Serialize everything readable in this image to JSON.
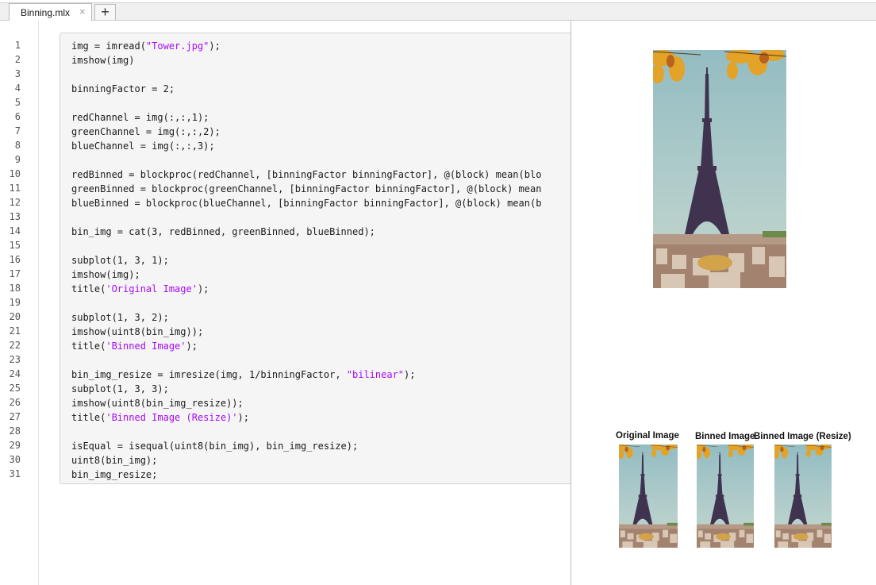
{
  "tab": {
    "label": "Binning.mlx",
    "close_glyph": "×",
    "new_glyph": "+"
  },
  "code": {
    "lines": [
      [
        {
          "t": "img = imread("
        },
        {
          "t": "\"Tower.jpg\"",
          "c": "str"
        },
        {
          "t": ");"
        }
      ],
      [
        {
          "t": "imshow(img)"
        }
      ],
      [],
      [
        {
          "t": "binningFactor = 2;"
        }
      ],
      [],
      [
        {
          "t": "redChannel = img(:,:,1);"
        }
      ],
      [
        {
          "t": "greenChannel = img(:,:,2);"
        }
      ],
      [
        {
          "t": "blueChannel = img(:,:,3);"
        }
      ],
      [],
      [
        {
          "t": "redBinned = blockproc(redChannel, [binningFactor binningFactor], @(block) mean(blo"
        }
      ],
      [
        {
          "t": "greenBinned = blockproc(greenChannel, [binningFactor binningFactor], @(block) mean"
        }
      ],
      [
        {
          "t": "blueBinned = blockproc(blueChannel, [binningFactor binningFactor], @(block) mean(b"
        }
      ],
      [],
      [
        {
          "t": "bin_img = cat(3, redBinned, greenBinned, blueBinned);"
        }
      ],
      [],
      [
        {
          "t": "subplot(1, 3, 1);"
        }
      ],
      [
        {
          "t": "imshow(img);"
        }
      ],
      [
        {
          "t": "title("
        },
        {
          "t": "'Original Image'",
          "c": "str"
        },
        {
          "t": ");"
        }
      ],
      [],
      [
        {
          "t": "subplot(1, 3, 2);"
        }
      ],
      [
        {
          "t": "imshow(uint8(bin_img));"
        }
      ],
      [
        {
          "t": "title("
        },
        {
          "t": "'Binned Image'",
          "c": "str"
        },
        {
          "t": ");"
        }
      ],
      [],
      [
        {
          "t": "bin_img_resize = imresize(img, 1/binningFactor, "
        },
        {
          "t": "\"bilinear\"",
          "c": "str"
        },
        {
          "t": ");"
        }
      ],
      [
        {
          "t": "subplot(1, 3, 3);"
        }
      ],
      [
        {
          "t": "imshow(uint8(bin_img_resize));"
        }
      ],
      [
        {
          "t": "title("
        },
        {
          "t": "'Binned Image (Resize)'",
          "c": "str"
        },
        {
          "t": ");"
        }
      ],
      [],
      [
        {
          "t": "isEqual = isequal(uint8(bin_img), bin_img_resize);"
        }
      ],
      [
        {
          "t": "uint8(bin_img);"
        }
      ],
      [
        {
          "t": "bin_img_resize;"
        }
      ]
    ]
  },
  "output": {
    "subplot_titles": [
      "Original Image",
      "Binned Image",
      "Binned Image (Resize)"
    ]
  },
  "colors": {
    "string": "#a709f5",
    "sky": "#9fc4c8",
    "tower": "#3b2f4a",
    "leaves": "#e0a020"
  }
}
